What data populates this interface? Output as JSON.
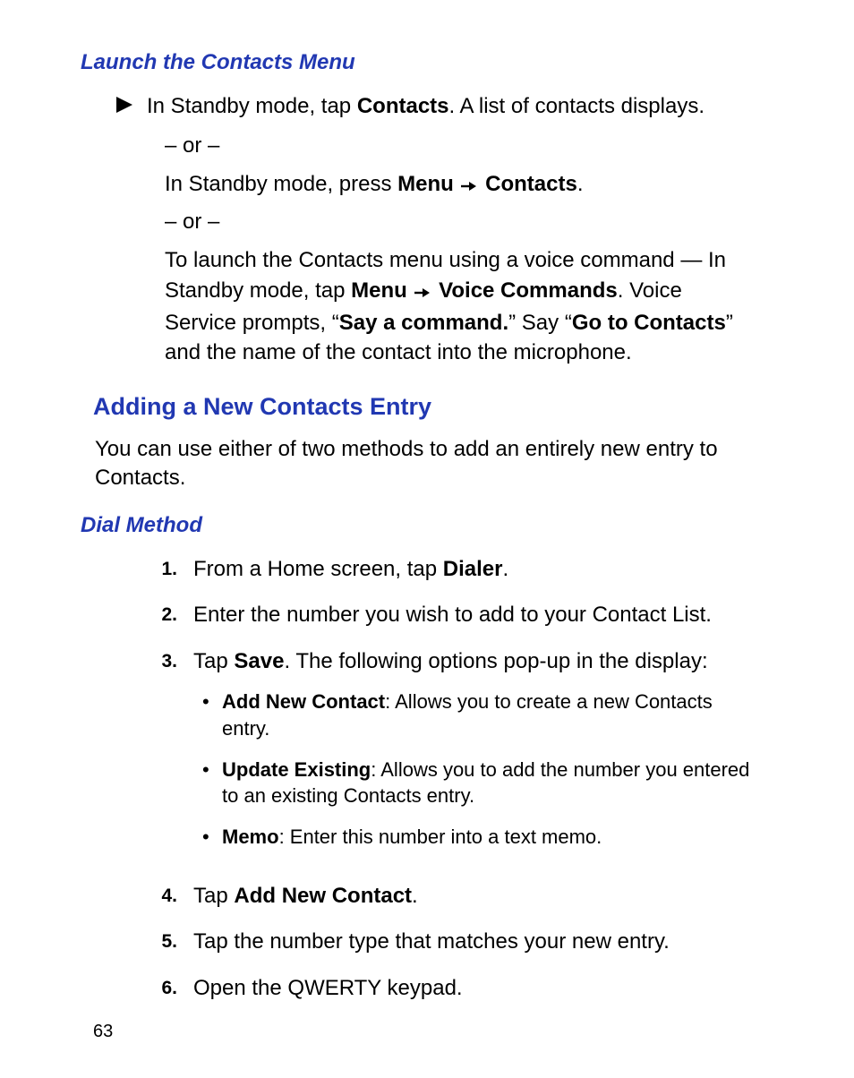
{
  "headings": {
    "launch": "Launch the Contacts Menu",
    "adding": "Adding a New Contacts Entry",
    "dial": "Dial Method"
  },
  "launch": {
    "line1_pre": "In Standby mode, tap ",
    "line1_b1": "Contacts",
    "line1_post": ". A list of contacts displays.",
    "or": "– or –",
    "line2_pre": "In Standby mode, press ",
    "line2_b1": "Menu  ",
    "line2_b2": " Contacts",
    "line2_post": ".",
    "line3_pre": "To launch the Contacts menu using a voice command — In Standby mode, tap ",
    "line3_b1": "Menu  ",
    "line3_b2": " Voice Commands",
    "line3_mid1": ". Voice Service prompts, “",
    "line3_b3": "Say a command.",
    "line3_mid2": "” Say “",
    "line3_b4": "Go to Contacts",
    "line3_post": "” and the name of the contact into the microphone."
  },
  "adding_para": "You can use either of two methods to add an entirely new entry to Contacts.",
  "steps": {
    "s1_pre": "From a Home screen, tap ",
    "s1_b": "Dialer",
    "s1_post": ".",
    "s2": "Enter the number you wish to add to your Contact List.",
    "s3_pre": "Tap ",
    "s3_b": "Save",
    "s3_post": ". The following options pop-up in the display:",
    "sub1_b": "Add New Contact",
    "sub1_t": ": Allows you to create a new Contacts entry.",
    "sub2_b": "Update Existing",
    "sub2_t": ": Allows you to add the number you entered to an existing Contacts entry.",
    "sub3_b": "Memo",
    "sub3_t": ": Enter this number into a text memo.",
    "s4_pre": "Tap ",
    "s4_b": "Add New Contact",
    "s4_post": ".",
    "s5": "Tap the number type that matches your new entry.",
    "s6": "Open the QWERTY keypad."
  },
  "nums": {
    "n1": "1.",
    "n2": "2.",
    "n3": "3.",
    "n4": "4.",
    "n5": "5.",
    "n6": "6."
  },
  "bullet": "•",
  "page_number": "63"
}
